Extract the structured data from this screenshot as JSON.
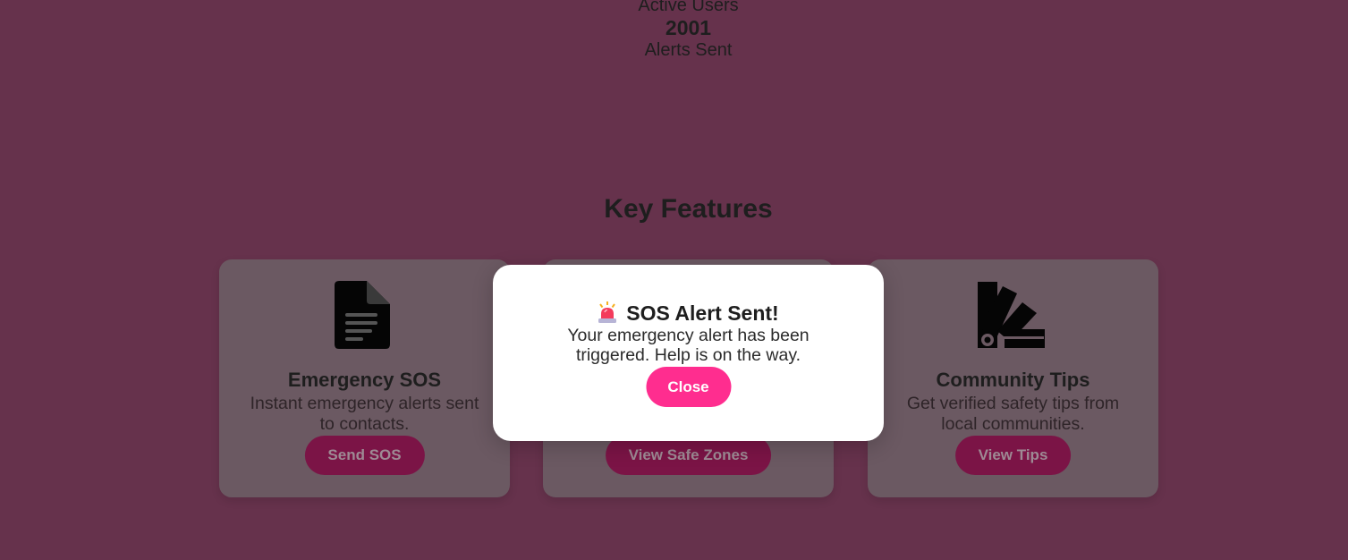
{
  "stats": {
    "users_label": "Active Users",
    "alerts_value": "2001",
    "alerts_label": "Alerts Sent"
  },
  "features": {
    "heading": "Key Features",
    "cards": [
      {
        "icon": "document-icon",
        "title": "Emergency SOS",
        "description": "Instant emergency alerts sent to contacts.",
        "button": "Send SOS"
      },
      {
        "icon": "map-icon",
        "title": "",
        "description": "",
        "button": "View Safe Zones"
      },
      {
        "icon": "swatchbook-icon",
        "title": "Community Tips",
        "description": "Get verified safety tips from local communities.",
        "button": "View Tips"
      }
    ]
  },
  "modal": {
    "icon": "siren-icon",
    "title": "SOS Alert Sent!",
    "message": "Your emergency alert has been triggered. Help is on the way.",
    "close_label": "Close"
  },
  "colors": {
    "page_background": "#66324c",
    "card_background": "#6b5962",
    "card_button": "#7b1446",
    "modal_button": "#ff2d8f",
    "modal_background": "#ffffff"
  }
}
